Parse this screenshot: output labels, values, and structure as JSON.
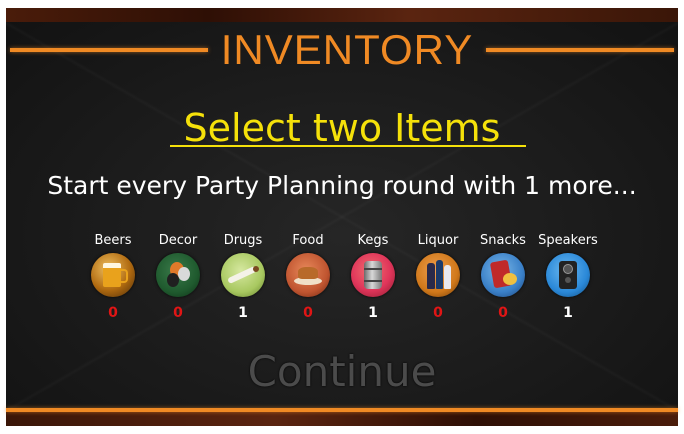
{
  "header": {
    "title": "INVENTORY"
  },
  "main": {
    "heading": "Select two Items",
    "description": "Start every Party Planning round with 1 more...",
    "continue_label": "Continue"
  },
  "items": [
    {
      "label": "Beers",
      "count": "0",
      "icon": "beer-mug-icon"
    },
    {
      "label": "Decor",
      "count": "0",
      "icon": "balloons-icon"
    },
    {
      "label": "Drugs",
      "count": "1",
      "icon": "joint-icon"
    },
    {
      "label": "Food",
      "count": "0",
      "icon": "food-plate-icon"
    },
    {
      "label": "Kegs",
      "count": "1",
      "icon": "keg-icon"
    },
    {
      "label": "Liquor",
      "count": "0",
      "icon": "liquor-bottles-icon"
    },
    {
      "label": "Snacks",
      "count": "0",
      "icon": "chips-bag-icon"
    },
    {
      "label": "Speakers",
      "count": "1",
      "icon": "speaker-icon"
    }
  ],
  "colors": {
    "accent_orange": "#f08a24",
    "heading_yellow": "#f5e10a",
    "zero_red": "#e01515",
    "continue_disabled": "#4b4b4b"
  }
}
